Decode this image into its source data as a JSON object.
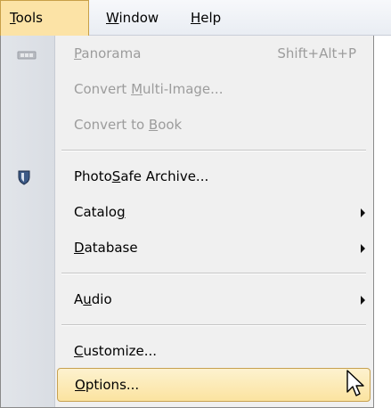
{
  "menubar": {
    "tools": "Tools",
    "window": "Window",
    "help": "Help"
  },
  "menu": {
    "panorama": {
      "label": "Panorama",
      "shortcut": "Shift+Alt+P",
      "enabled": false,
      "icon": "panorama-icon"
    },
    "convert_multi": {
      "label": "Convert Multi-Image...",
      "enabled": false
    },
    "convert_book": {
      "label": "Convert to Book",
      "enabled": false
    },
    "photosafe": {
      "label": "PhotoSafe Archive...",
      "enabled": true,
      "icon": "shield-icon"
    },
    "catalog": {
      "label": "Catalog",
      "submenu": true
    },
    "database": {
      "label": "Database",
      "submenu": true
    },
    "audio": {
      "label": "Audio",
      "submenu": true
    },
    "customize": {
      "label": "Customize..."
    },
    "options": {
      "label": "Options...",
      "highlighted": true
    }
  },
  "colors": {
    "highlight": "#fbe3a0",
    "highlight_border": "#c7a151",
    "disabled_text": "#9c9c9c"
  }
}
